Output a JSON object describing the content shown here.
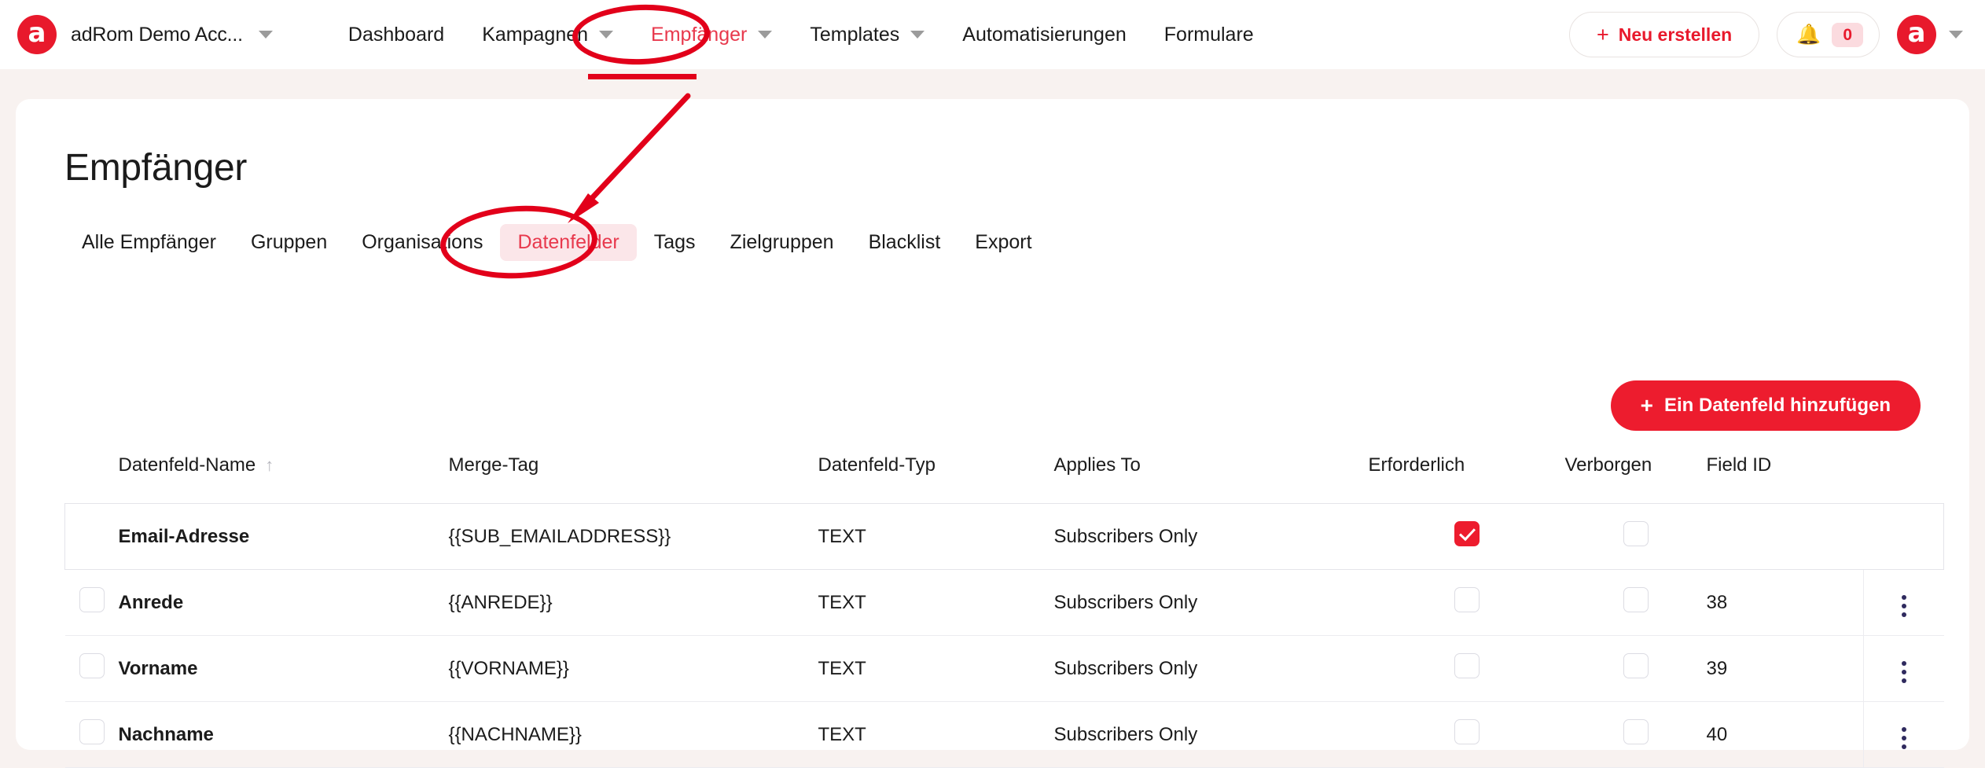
{
  "topbar": {
    "logo_letter": "a",
    "account_name": "adRom Demo Acc...",
    "nav": [
      {
        "label": "Dashboard",
        "has_caret": false,
        "active": false
      },
      {
        "label": "Kampagnen",
        "has_caret": true,
        "active": false
      },
      {
        "label": "Empfänger",
        "has_caret": true,
        "active": true
      },
      {
        "label": "Templates",
        "has_caret": true,
        "active": false
      },
      {
        "label": "Automatisierungen",
        "has_caret": false,
        "active": false
      },
      {
        "label": "Formulare",
        "has_caret": false,
        "active": false
      }
    ],
    "new_button_label": "Neu erstellen",
    "new_button_plus": "+",
    "notification_count": "0",
    "avatar_letter": "a"
  },
  "page": {
    "title": "Empfänger",
    "tabs": [
      {
        "label": "Alle Empfänger",
        "active": false
      },
      {
        "label": "Gruppen",
        "active": false
      },
      {
        "label": "Organisations",
        "active": false
      },
      {
        "label": "Datenfelder",
        "active": true
      },
      {
        "label": "Tags",
        "active": false
      },
      {
        "label": "Zielgruppen",
        "active": false
      },
      {
        "label": "Blacklist",
        "active": false
      },
      {
        "label": "Export",
        "active": false
      }
    ],
    "add_button_label": "Ein Datenfeld hinzufügen",
    "add_button_plus": "+"
  },
  "table": {
    "sort_indicator": "↑",
    "headers": {
      "name": "Datenfeld-Name",
      "merge_tag": "Merge-Tag",
      "type": "Datenfeld-Typ",
      "applies_to": "Applies To",
      "required": "Erforderlich",
      "hidden": "Verborgen",
      "field_id": "Field ID"
    },
    "rows": [
      {
        "selectable": false,
        "locked": true,
        "name": "Email-Adresse",
        "merge_tag": "{{SUB_EMAILADDRESS}}",
        "type": "TEXT",
        "applies_to": "Subscribers Only",
        "required": true,
        "hidden": false,
        "field_id": "",
        "has_menu": false
      },
      {
        "selectable": true,
        "locked": false,
        "name": "Anrede",
        "merge_tag": "{{ANREDE}}",
        "type": "TEXT",
        "applies_to": "Subscribers Only",
        "required": false,
        "hidden": false,
        "field_id": "38",
        "has_menu": true
      },
      {
        "selectable": true,
        "locked": false,
        "name": "Vorname",
        "merge_tag": "{{VORNAME}}",
        "type": "TEXT",
        "applies_to": "Subscribers Only",
        "required": false,
        "hidden": false,
        "field_id": "39",
        "has_menu": true
      },
      {
        "selectable": true,
        "locked": false,
        "name": "Nachname",
        "merge_tag": "{{NACHNAME}}",
        "type": "TEXT",
        "applies_to": "Subscribers Only",
        "required": false,
        "hidden": false,
        "field_id": "40",
        "has_menu": true
      }
    ]
  },
  "colors": {
    "brand_red": "#e8192c",
    "accent_red": "#ed1c2e",
    "annotation_red": "#e2001a",
    "tab_active_bg": "#fbe6e9",
    "page_bg": "#f8f2f0",
    "kebab": "#2f2a5e"
  }
}
